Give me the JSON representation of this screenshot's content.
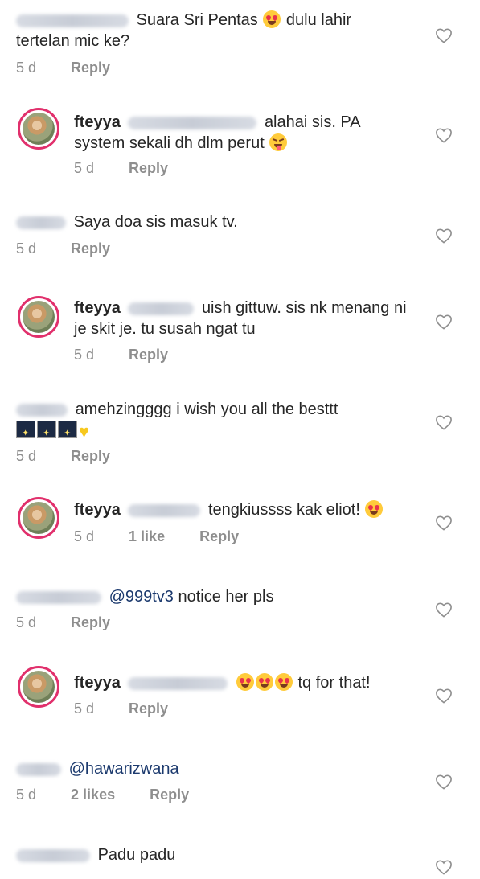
{
  "comments": [
    {
      "text": "Suara Sri Pentas",
      "text2": "dulu lahir",
      "line2": "tertelan mic ke?",
      "time": "5 d",
      "reply": "Reply"
    },
    {
      "user": "fteyya",
      "text": "alahai sis. PA",
      "line2": "system sekali dh dlm perut",
      "time": "5 d",
      "reply": "Reply"
    },
    {
      "text": "Saya doa sis masuk tv.",
      "time": "5 d",
      "reply": "Reply"
    },
    {
      "user": "fteyya",
      "text": "uish gittuw. sis nk menang ni",
      "line2": "je skit je. tu susah ngat tu",
      "time": "5 d",
      "reply": "Reply"
    },
    {
      "text": "amehzingggg i wish you all the besttt",
      "time": "5 d",
      "reply": "Reply"
    },
    {
      "user": "fteyya",
      "text": "tengkiussss kak eliot!",
      "time": "5 d",
      "likes": "1 like",
      "reply": "Reply"
    },
    {
      "mention": "@999tv3",
      "text": "notice her pls",
      "time": "5 d",
      "reply": "Reply"
    },
    {
      "user": "fteyya",
      "text": "tq for that!",
      "time": "5 d",
      "reply": "Reply"
    },
    {
      "mention": "@hawarizwana",
      "time": "5 d",
      "likes": "2 likes",
      "reply": "Reply"
    },
    {
      "text": "Padu padu"
    }
  ],
  "icons": {
    "like": "heart-outline-icon",
    "avatar": "profile-avatar"
  },
  "colors": {
    "ring": "#e1306c",
    "meta": "#8e8e8e",
    "mention": "#1c3a6e"
  }
}
